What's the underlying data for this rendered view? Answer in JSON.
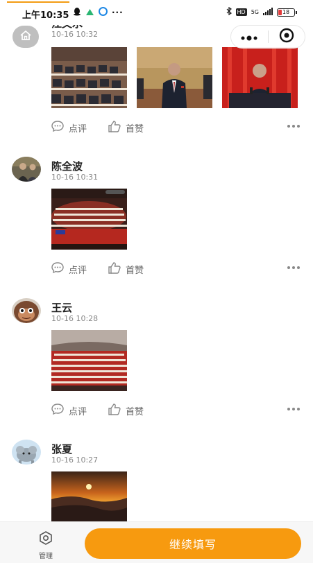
{
  "status_bar": {
    "time": "上午10:35",
    "network": "5G",
    "hd": "HD",
    "battery": "18"
  },
  "posts": [
    {
      "name": "江文水",
      "time": "10-16 10:32",
      "comment_label": "点评",
      "like_label": "首赞"
    },
    {
      "name": "陈全波",
      "time": "10-16 10:31",
      "comment_label": "点评",
      "like_label": "首赞"
    },
    {
      "name": "王云",
      "time": "10-16 10:28",
      "comment_label": "点评",
      "like_label": "首赞"
    },
    {
      "name": "张夏",
      "time": "10-16 10:27"
    }
  ],
  "bottom_bar": {
    "manage_label": "管理",
    "continue_label": "继续填写"
  },
  "colors": {
    "accent": "#f79a0f",
    "progress": "#f39c12"
  }
}
